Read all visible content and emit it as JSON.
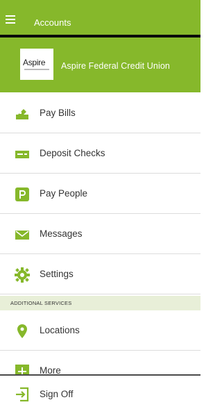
{
  "app": {
    "title": "Accounts",
    "accent_color": "#86b82b"
  },
  "header": {
    "institution_name": "Aspire Federal Credit Union",
    "logo_text": "Aspire"
  },
  "menu": {
    "items": [
      {
        "label": "Pay Bills",
        "icon": "pay-bills-icon"
      },
      {
        "label": "Deposit Checks",
        "icon": "deposit-checks-icon"
      },
      {
        "label": "Pay People",
        "icon": "pay-people-icon"
      },
      {
        "label": "Messages",
        "icon": "envelope-icon"
      },
      {
        "label": "Settings",
        "icon": "gear-icon"
      }
    ]
  },
  "additional_services": {
    "heading": "ADDITIONAL SERVICES",
    "items": [
      {
        "label": "Locations",
        "icon": "location-pin-icon"
      },
      {
        "label": "More",
        "icon": "plus-icon"
      }
    ]
  },
  "footer": {
    "sign_off_label": "Sign Off",
    "icon": "sign-off-icon"
  }
}
